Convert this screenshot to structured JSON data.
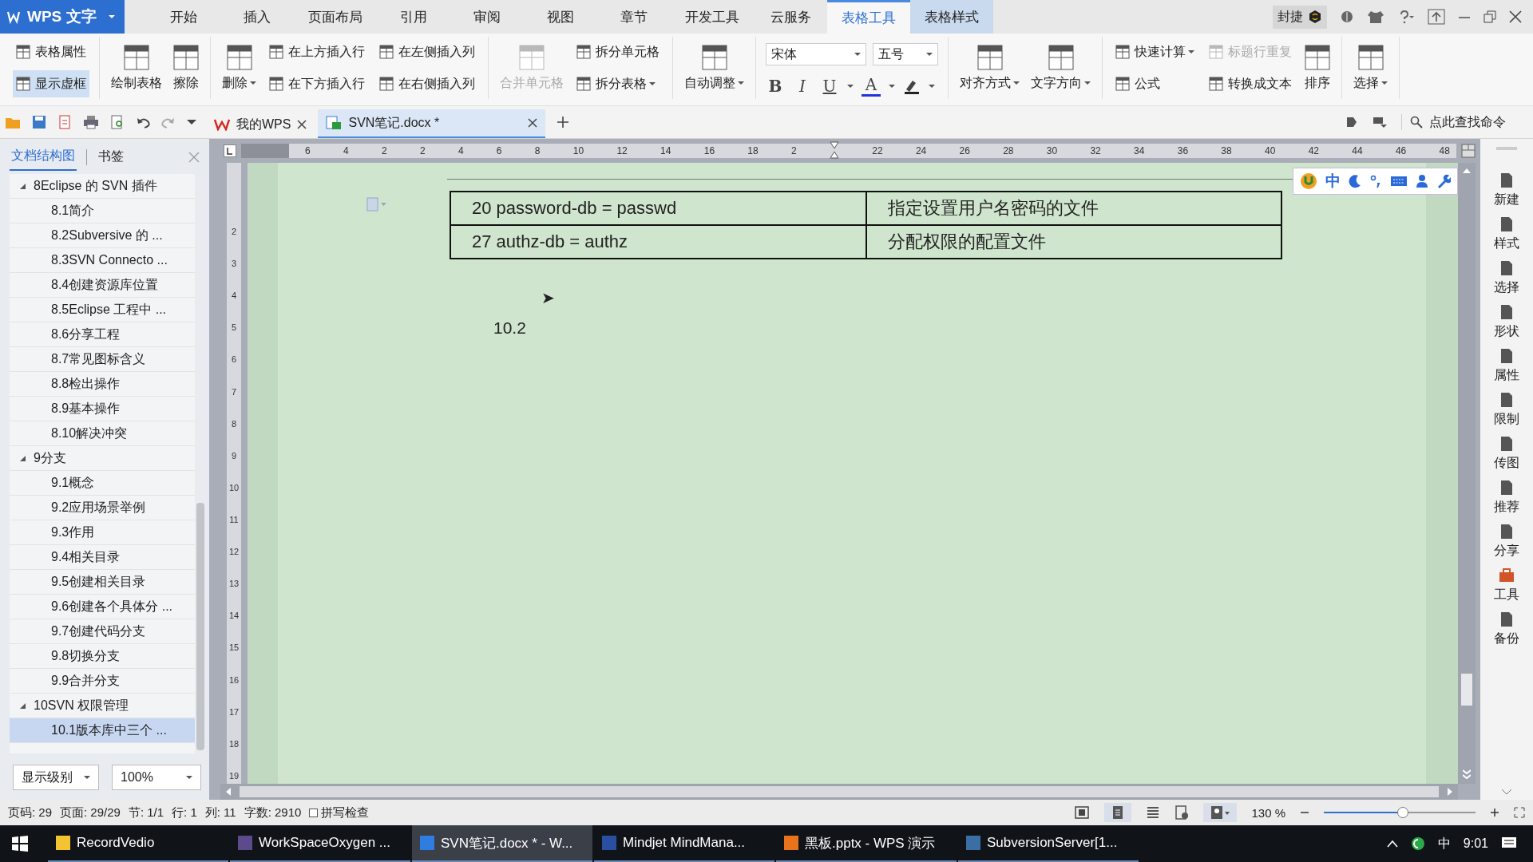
{
  "app_button": {
    "label": "WPS 文字"
  },
  "menu_tabs": [
    {
      "label": "开始",
      "selected": false,
      "kind": "normal"
    },
    {
      "label": "插入",
      "selected": false,
      "kind": "normal"
    },
    {
      "label": "页面布局",
      "selected": false,
      "kind": "normal"
    },
    {
      "label": "引用",
      "selected": false,
      "kind": "normal"
    },
    {
      "label": "审阅",
      "selected": false,
      "kind": "normal"
    },
    {
      "label": "视图",
      "selected": false,
      "kind": "normal"
    },
    {
      "label": "章节",
      "selected": false,
      "kind": "normal"
    },
    {
      "label": "开发工具",
      "selected": false,
      "kind": "normal"
    },
    {
      "label": "云服务",
      "selected": false,
      "kind": "normal"
    },
    {
      "label": "表格工具",
      "selected": true,
      "kind": "context"
    },
    {
      "label": "表格样式",
      "selected": false,
      "kind": "context"
    }
  ],
  "account": {
    "name": "封捷"
  },
  "ribbon": [
    {
      "kind": "items",
      "columns": [
        [
          {
            "label": "表格属性",
            "kind": "small",
            "disabled": false
          },
          {
            "label": "显示虚框",
            "kind": "toggle",
            "on": true,
            "disabled": false
          }
        ]
      ]
    },
    {
      "kind": "items",
      "columns": [
        [
          {
            "label": "绘制表格",
            "kind": "big",
            "disabled": false
          }
        ],
        [
          {
            "label": "擦除",
            "kind": "big",
            "disabled": false
          }
        ]
      ]
    },
    {
      "kind": "items",
      "columns": [
        [
          {
            "label": "删除",
            "kind": "bigmenu",
            "disabled": false
          }
        ],
        [
          {
            "label": "在上方插入行",
            "kind": "small",
            "disabled": false
          },
          {
            "label": "在下方插入行",
            "kind": "small",
            "disabled": false
          }
        ],
        [
          {
            "label": "在左侧插入列",
            "kind": "small",
            "disabled": false
          },
          {
            "label": "在右侧插入列",
            "kind": "small",
            "disabled": false
          }
        ]
      ]
    },
    {
      "kind": "items",
      "columns": [
        [
          {
            "label": "合并单元格",
            "kind": "big",
            "disabled": true
          }
        ],
        [
          {
            "label": "拆分单元格",
            "kind": "small",
            "disabled": false
          },
          {
            "label": "拆分表格",
            "kind": "smallmenu",
            "disabled": false
          }
        ]
      ]
    },
    {
      "kind": "items",
      "columns": [
        [
          {
            "label": "自动调整",
            "kind": "bigmenu",
            "disabled": false
          }
        ]
      ]
    },
    {
      "kind": "font",
      "font": "宋体",
      "size": "五号",
      "format": [
        "B",
        "I",
        "U",
        "A"
      ]
    },
    {
      "kind": "items",
      "columns": [
        [
          {
            "label": "对齐方式",
            "kind": "bigmenu",
            "disabled": false
          }
        ],
        [
          {
            "label": "文字方向",
            "kind": "bigmenu",
            "disabled": false
          }
        ]
      ]
    },
    {
      "kind": "items",
      "columns": [
        [
          {
            "label": "快速计算",
            "kind": "smallmenu",
            "disabled": false
          },
          {
            "label": "公式",
            "kind": "small",
            "disabled": false
          }
        ],
        [
          {
            "label": "标题行重复",
            "kind": "small",
            "disabled": true
          },
          {
            "label": "转换成文本",
            "kind": "small",
            "disabled": false
          }
        ],
        [
          {
            "label": "排序",
            "kind": "big",
            "disabled": false
          }
        ]
      ]
    },
    {
      "kind": "items",
      "columns": [
        [
          {
            "label": "选择",
            "kind": "bigmenu",
            "disabled": false
          }
        ]
      ]
    }
  ],
  "doc_tabs": [
    {
      "label": "我的WPS",
      "selected": false
    },
    {
      "label": "SVN笔记.docx *",
      "selected": true
    }
  ],
  "command_search": {
    "placeholder": "点此查找命令"
  },
  "ruler": {
    "labels": [
      "6",
      "4",
      "2",
      "2",
      "4",
      "6",
      "8",
      "10",
      "12",
      "14",
      "16",
      "18",
      "2",
      "22",
      "24",
      "26",
      "28",
      "30",
      "32",
      "34",
      "36",
      "38",
      "40",
      "42",
      "44",
      "46",
      "48"
    ],
    "vertical_labels": [
      "2",
      "3",
      "4",
      "5",
      "6",
      "7",
      "8",
      "9",
      "10",
      "11",
      "12",
      "13",
      "14",
      "15",
      "16",
      "17",
      "18",
      "19"
    ]
  },
  "panel": {
    "tabs": [
      {
        "label": "文档结构图",
        "selected": true
      },
      {
        "label": "书签",
        "selected": false
      }
    ],
    "tree": [
      {
        "label": "8Eclipse 的 SVN 插件",
        "expanded": true,
        "selected": false,
        "children": [
          {
            "label": "8.1简介",
            "selected": false
          },
          {
            "label": "8.2Subversive 的 ...",
            "selected": false
          },
          {
            "label": "8.3SVN Connecto ...",
            "selected": false
          },
          {
            "label": "8.4创建资源库位置",
            "selected": false
          },
          {
            "label": "8.5Eclipse 工程中 ...",
            "selected": false
          },
          {
            "label": "8.6分享工程",
            "selected": false
          },
          {
            "label": "8.7常见图标含义",
            "selected": false
          },
          {
            "label": "8.8检出操作",
            "selected": false
          },
          {
            "label": "8.9基本操作",
            "selected": false
          },
          {
            "label": "8.10解决冲突",
            "selected": false
          }
        ]
      },
      {
        "label": "9分支",
        "expanded": true,
        "selected": false,
        "children": [
          {
            "label": "9.1概念",
            "selected": false
          },
          {
            "label": "9.2应用场景举例",
            "selected": false
          },
          {
            "label": "9.3作用",
            "selected": false
          },
          {
            "label": "9.4相关目录",
            "selected": false
          },
          {
            "label": "9.5创建相关目录",
            "selected": false
          },
          {
            "label": "9.6创建各个具体分 ...",
            "selected": false
          },
          {
            "label": "9.7创建代码分支",
            "selected": false
          },
          {
            "label": "9.8切换分支",
            "selected": false
          },
          {
            "label": "9.9合并分支",
            "selected": false
          }
        ]
      },
      {
        "label": "10SVN 权限管理",
        "expanded": true,
        "selected": false,
        "children": [
          {
            "label": "10.1版本库中三个 ...",
            "selected": true
          }
        ]
      }
    ],
    "level_dropdown": {
      "value": "显示级别"
    },
    "zoom_dropdown": {
      "value": "100%"
    }
  },
  "document": {
    "table": {
      "rows": [
        [
          "20 password-db = passwd",
          "指定设置用户名密码的文件"
        ],
        [
          "27 authz-db = authz",
          "分配权限的配置文件"
        ]
      ]
    },
    "paragraphs": [
      {
        "bullet": "➤",
        "text": "10.2"
      }
    ]
  },
  "ime_toolbar": {
    "mode": "中"
  },
  "right_sidebar": [
    "新建",
    "样式",
    "选择",
    "形状",
    "属性",
    "限制",
    "传图",
    "推荐",
    "分享",
    "工具",
    "备份"
  ],
  "status_bar": {
    "fields": [
      "页码: 29",
      "页面: 29/29",
      "节: 1/1",
      "行: 1",
      "列: 11",
      "字数: 2910"
    ],
    "spell_check": {
      "label": "拼写检查",
      "checked": false
    },
    "zoom": "130 %",
    "zoom_level": {
      "level": 0.52
    }
  },
  "taskbar": {
    "items": [
      {
        "label": "RecordVedio",
        "selected": false,
        "color": "#f4c430"
      },
      {
        "label": "WorkSpaceOxygen ...",
        "selected": false,
        "color": "#5b4a8c"
      },
      {
        "label": "SVN笔记.docx * - W...",
        "selected": true,
        "color": "#2f7de1"
      },
      {
        "label": "Mindjet MindMana...",
        "selected": false,
        "color": "#2a4fa0"
      },
      {
        "label": "黑板.pptx - WPS 演示",
        "selected": false,
        "color": "#e8731c"
      },
      {
        "label": "SubversionServer[1...",
        "selected": false,
        "color": "#3a6ea5"
      }
    ],
    "ime": "中",
    "time": "9:01"
  }
}
